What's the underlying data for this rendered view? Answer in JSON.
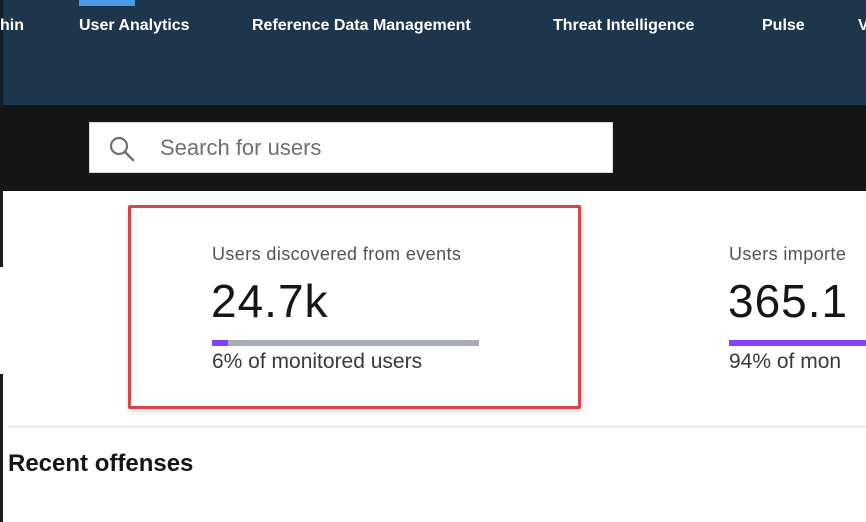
{
  "nav": {
    "tabs": [
      {
        "label": "hin",
        "active": false
      },
      {
        "label": "User Analytics",
        "active": true
      },
      {
        "label": "Reference Data Management",
        "active": false
      },
      {
        "label": "Threat Intelligence",
        "active": false
      },
      {
        "label": "Pulse",
        "active": false
      },
      {
        "label": "V",
        "active": false
      }
    ],
    "accent_color": "#4a98e8"
  },
  "search": {
    "placeholder": "Search for users",
    "value": "",
    "icon": "search-icon"
  },
  "metrics": [
    {
      "label": "Users discovered from events",
      "value": "24.7k",
      "progress_fraction": 0.06,
      "subtext": "6% of monitored users",
      "highlighted": true,
      "bar_color": "#8a3ffc"
    },
    {
      "label": "Users importe",
      "value": "365.1",
      "progress_fraction": 0.94,
      "subtext": "94% of mon",
      "highlighted": false,
      "bar_color": "#8a3ffc"
    }
  ],
  "highlight_color": "#d9434c",
  "section": {
    "title": "Recent offenses"
  }
}
